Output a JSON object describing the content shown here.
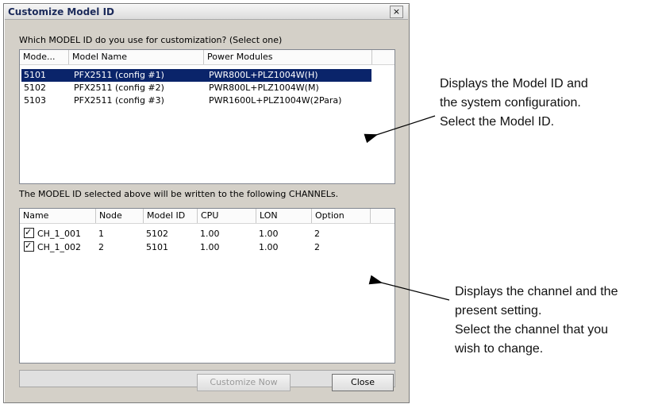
{
  "dialog": {
    "title": "Customize Model ID",
    "close_glyph": "×",
    "prompt": "Which MODEL ID do you use for customization? (Select one)",
    "written_note": "The MODEL ID selected above will be written to the following CHANNELs."
  },
  "model_list": {
    "headers": [
      "Mode...",
      "Model Name",
      "Power Modules"
    ],
    "rows": [
      {
        "id": "5101",
        "name": "PFX2511 (config #1)",
        "power": "PWR800L+PLZ1004W(H)",
        "selected": true
      },
      {
        "id": "5102",
        "name": "PFX2511 (config #2)",
        "power": "PWR800L+PLZ1004W(M)",
        "selected": false
      },
      {
        "id": "5103",
        "name": "PFX2511 (config #3)",
        "power": "PWR1600L+PLZ1004W(2Para)",
        "selected": false
      }
    ]
  },
  "channel_list": {
    "headers": [
      "Name",
      "Node",
      "Model ID",
      "CPU",
      "LON",
      "Option"
    ],
    "rows": [
      {
        "name": "CH_1_001",
        "node": "1",
        "model_id": "5102",
        "cpu": "1.00",
        "lon": "1.00",
        "option": "2",
        "checked": true
      },
      {
        "name": "CH_1_002",
        "node": "2",
        "model_id": "5101",
        "cpu": "1.00",
        "lon": "1.00",
        "option": "2",
        "checked": true
      }
    ]
  },
  "buttons": {
    "customize_now": "Customize Now",
    "close": "Close"
  },
  "annotations": {
    "top": [
      "Displays the Model ID and",
      "the system configuration.",
      "Select the Model ID."
    ],
    "bottom": [
      "Displays the channel and the",
      "present setting.",
      "Select the channel that you",
      "wish to change."
    ]
  },
  "colors": {
    "selection": "#0a246a",
    "dialog_face": "#d4d0c8"
  }
}
